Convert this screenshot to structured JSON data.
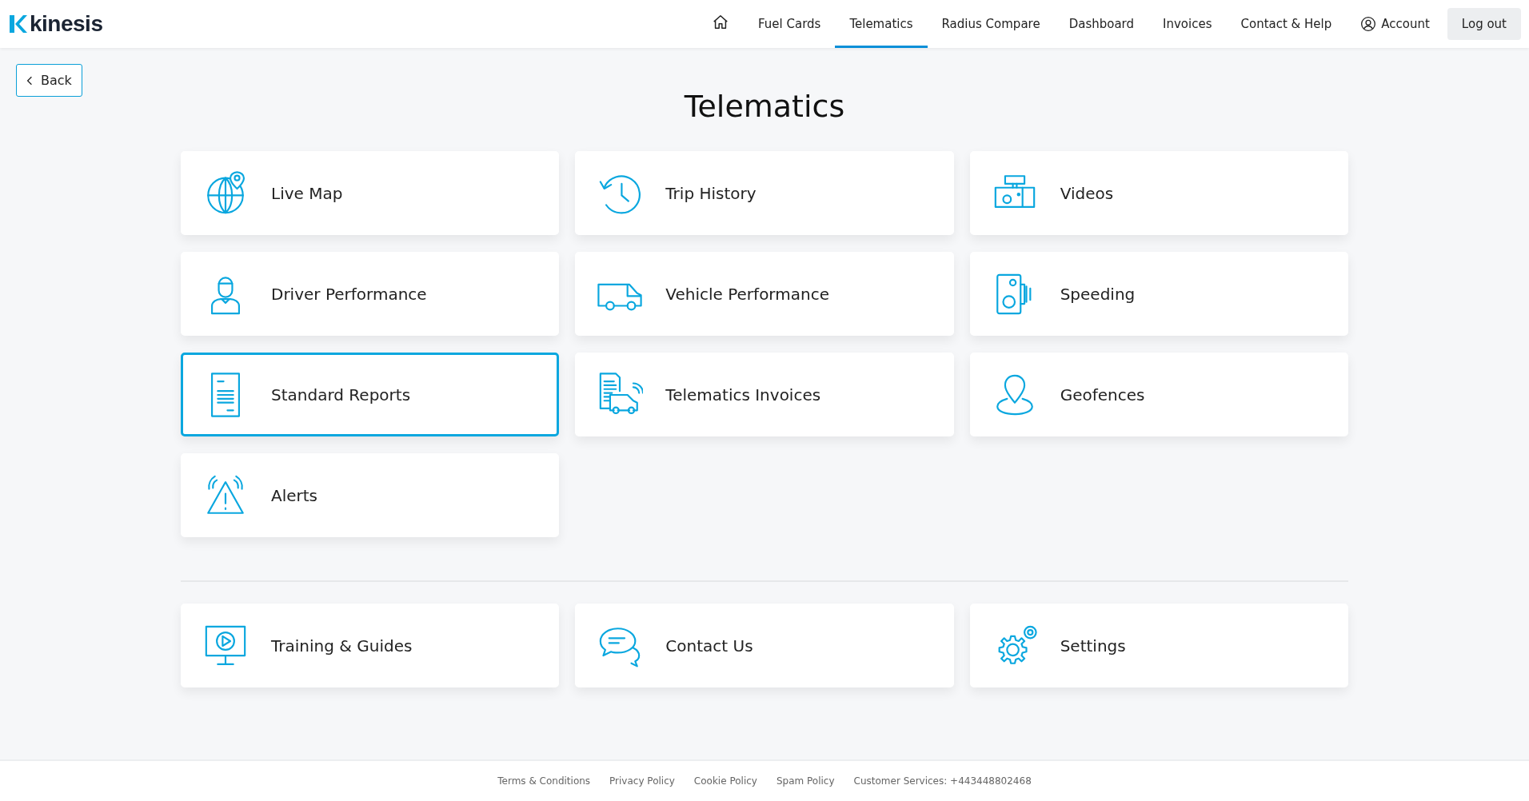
{
  "header": {
    "logo": "kinesis",
    "nav": [
      {
        "label": "Fuel Cards",
        "selected": false
      },
      {
        "label": "Telematics",
        "selected": true
      },
      {
        "label": "Radius Compare",
        "selected": false
      },
      {
        "label": "Dashboard",
        "selected": false
      },
      {
        "label": "Invoices",
        "selected": false
      },
      {
        "label": "Contact & Help",
        "selected": false
      }
    ],
    "account": "Account",
    "logout": "Log out"
  },
  "back": "Back",
  "title": "Telematics",
  "tiles": [
    {
      "label": "Live Map",
      "selected": false
    },
    {
      "label": "Trip History",
      "selected": false
    },
    {
      "label": "Videos",
      "selected": false
    },
    {
      "label": "Driver Performance",
      "selected": false
    },
    {
      "label": "Vehicle Performance",
      "selected": false
    },
    {
      "label": "Speeding",
      "selected": false
    },
    {
      "label": "Standard Reports",
      "selected": true
    },
    {
      "label": "Telematics Invoices",
      "selected": false
    },
    {
      "label": "Geofences",
      "selected": false
    },
    {
      "label": "Alerts",
      "selected": false
    }
  ],
  "support_tiles": [
    {
      "label": "Training & Guides",
      "selected": false
    },
    {
      "label": "Contact Us",
      "selected": false
    },
    {
      "label": "Settings",
      "selected": false
    }
  ],
  "footer": [
    "Terms & Conditions",
    "Privacy Policy",
    "Cookie Policy",
    "Spam Policy",
    "Customer Services: +443448802468"
  ]
}
